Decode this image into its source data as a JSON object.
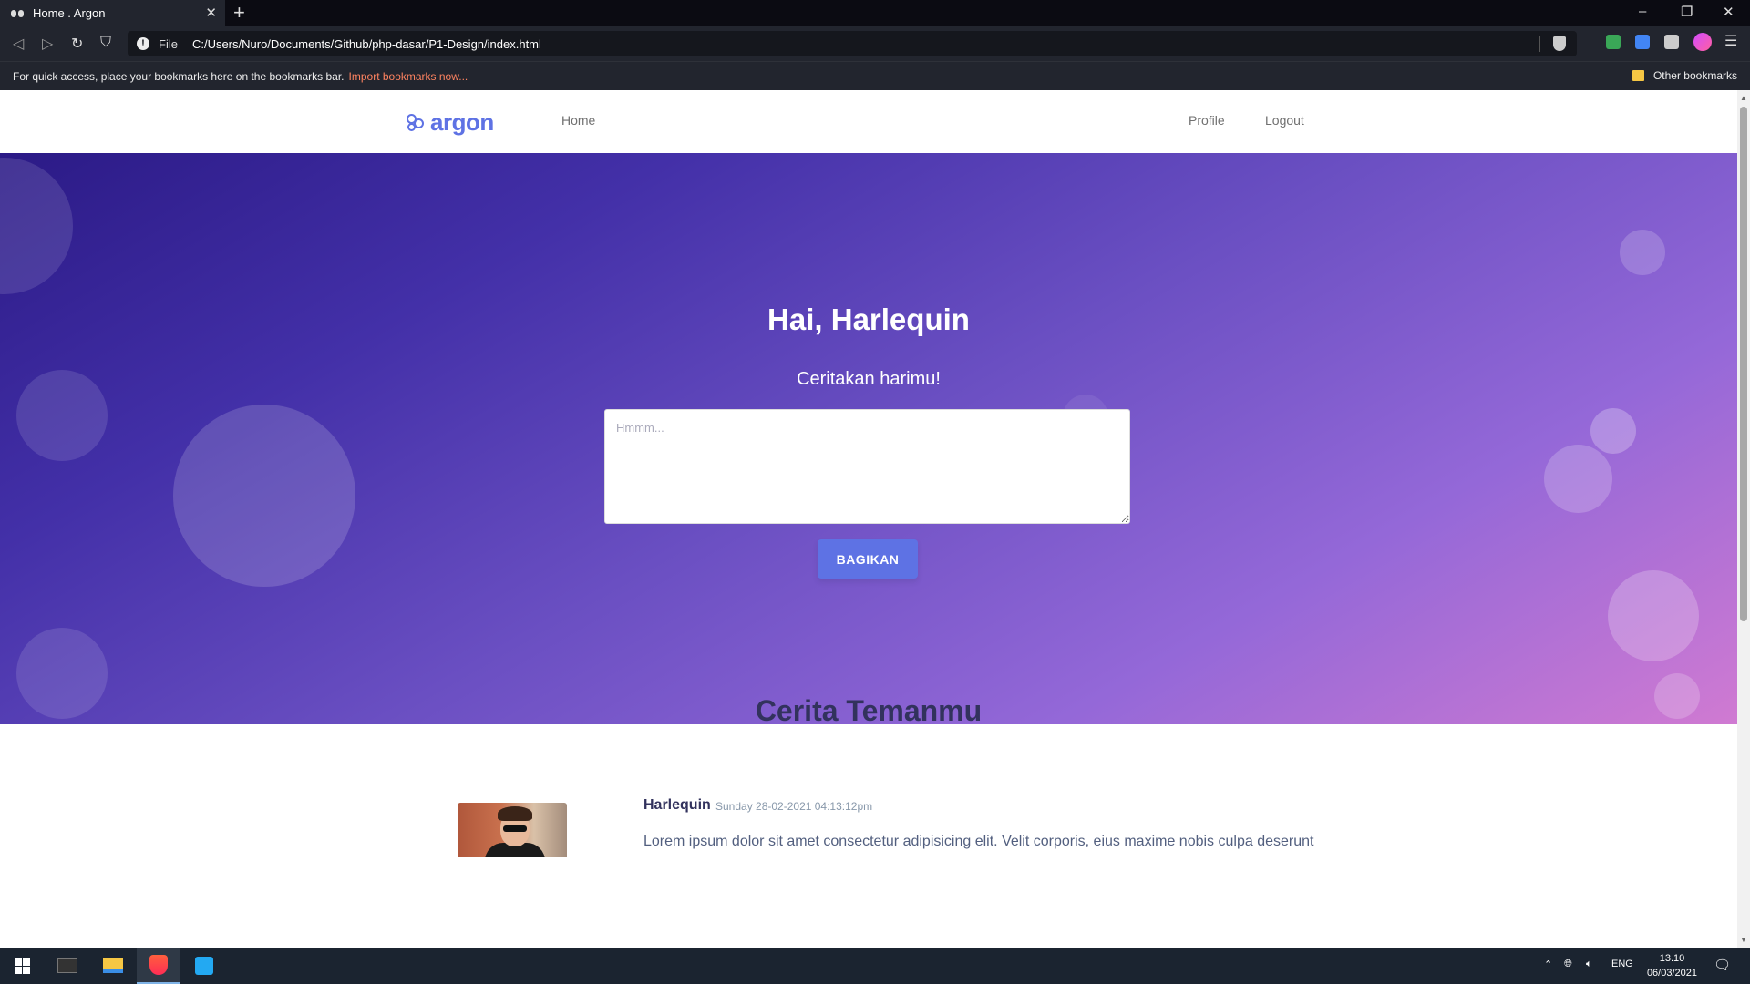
{
  "browser": {
    "tab_title": "Home . Argon",
    "tab_close": "✕",
    "new_tab": "+",
    "url_scheme": "File",
    "url": "C:/Users/Nuro/Documents/Github/php-dasar/P1-Design/index.html",
    "bookmarks_hint": "For quick access, place your bookmarks here on the bookmarks bar.",
    "bookmarks_import": "Import bookmarks now...",
    "other_bookmarks": "Other bookmarks",
    "minimize": "–",
    "restore": "❐",
    "close": "✕"
  },
  "navbar": {
    "brand": "argon",
    "home": "Home",
    "profile": "Profile",
    "logout": "Logout"
  },
  "hero": {
    "greeting": "Hai, Harlequin",
    "prompt": "Ceritakan harimu!",
    "input_placeholder": "Hmmm...",
    "share_button": "BAGIKAN"
  },
  "friends": {
    "title": "Cerita Temanmu",
    "posts": [
      {
        "author": "Harlequin",
        "date": "Sunday 28-02-2021 04:13:12pm",
        "body": "Lorem ipsum dolor sit amet consectetur adipisicing elit. Velit corporis, eius maxime nobis culpa deserunt"
      }
    ]
  },
  "taskbar": {
    "language": "ENG",
    "time": "13.10",
    "date": "06/03/2021"
  },
  "colors": {
    "primary": "#5e72e4",
    "heading": "#32325d",
    "hero_gradient_start": "#2b1a86",
    "hero_gradient_end": "#d07ad2"
  }
}
